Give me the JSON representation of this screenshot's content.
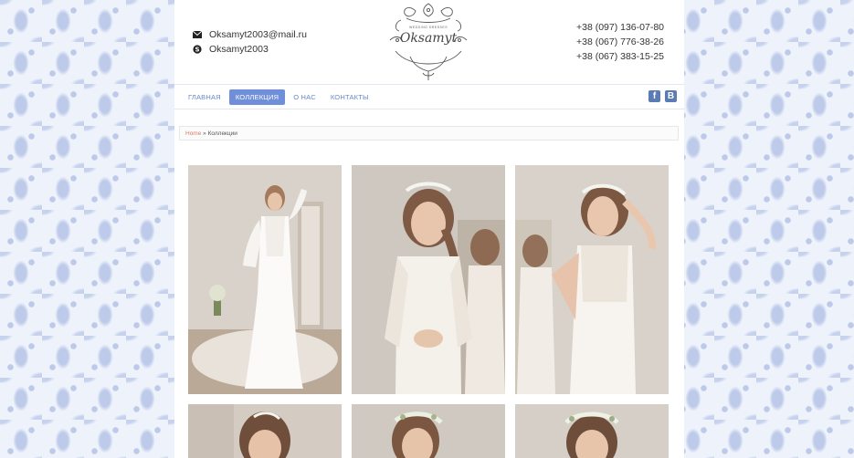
{
  "header": {
    "email": "Oksamyt2003@mail.ru",
    "skype": "Oksamyt2003",
    "phones": [
      "+38 (097) 136-07-80",
      "+38 (067) 776-38-26",
      "+38 (067) 383-15-25"
    ],
    "logo_text": "Oksamyt",
    "logo_subtext": "WEDDING DRESSES"
  },
  "nav": {
    "items": [
      {
        "label": "ГЛАВНАЯ",
        "active": false
      },
      {
        "label": "КОЛЛЕКЦИЯ",
        "active": true
      },
      {
        "label": "О НАС",
        "active": false
      },
      {
        "label": "КОНТАКТЫ",
        "active": false
      }
    ],
    "social": [
      {
        "icon": "facebook-icon",
        "glyph": "f"
      },
      {
        "icon": "vk-icon",
        "glyph": "B"
      }
    ]
  },
  "breadcrumb": {
    "home": "Home",
    "separator": "»",
    "current": "Коллекции"
  },
  "colors": {
    "accent": "#6f8fd9",
    "nav_text": "#6a86c9",
    "breadcrumb_home": "#d07d6b",
    "social": "#5b7bb5"
  },
  "gallery": {
    "items": [
      {
        "name": "dress-photo-1"
      },
      {
        "name": "dress-photo-2"
      },
      {
        "name": "dress-photo-3"
      },
      {
        "name": "dress-photo-4"
      },
      {
        "name": "dress-photo-5"
      },
      {
        "name": "dress-photo-6"
      }
    ]
  }
}
